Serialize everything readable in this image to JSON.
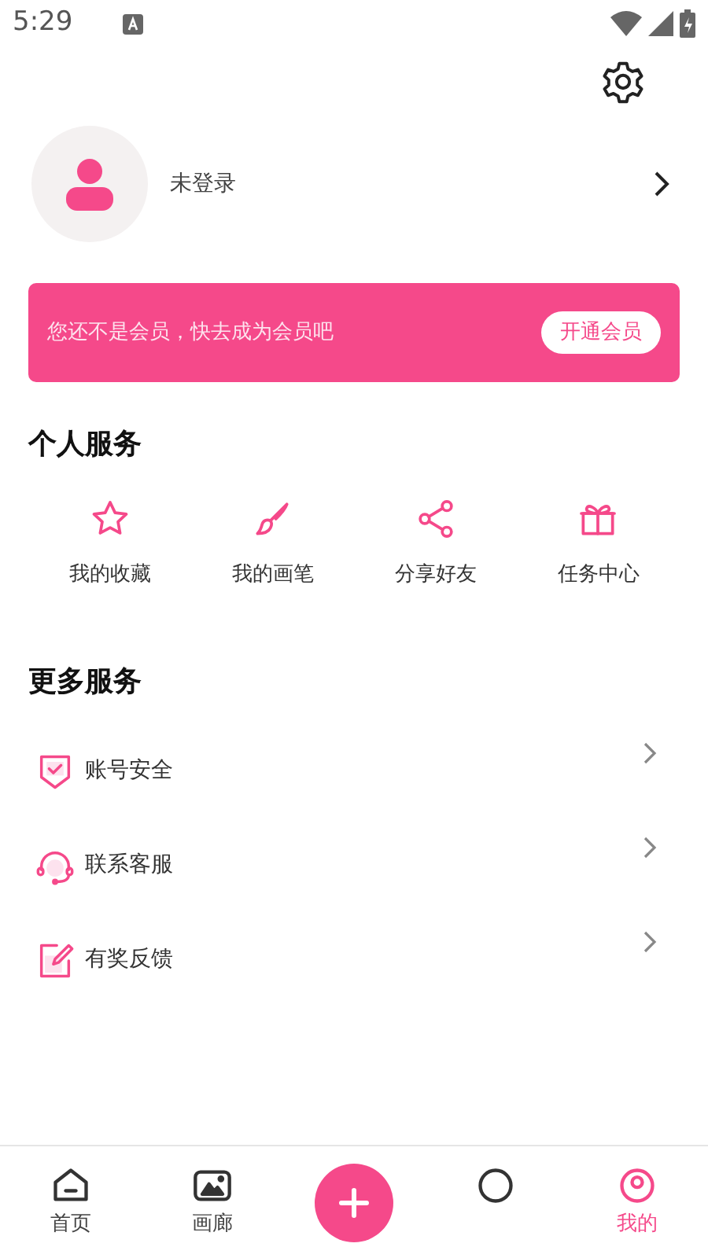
{
  "status_bar": {
    "time": "5:29"
  },
  "profile": {
    "name": "未登录"
  },
  "vip_banner": {
    "text": "您还不是会员，快去成为会员吧",
    "button": "开通会员"
  },
  "personal_services": {
    "title": "个人服务",
    "items": [
      {
        "kind": "star",
        "label": "我的收藏"
      },
      {
        "kind": "brush",
        "label": "我的画笔"
      },
      {
        "kind": "share",
        "label": "分享好友"
      },
      {
        "kind": "gift",
        "label": "任务中心"
      }
    ]
  },
  "more_services": {
    "title": "更多服务",
    "items": [
      {
        "kind": "shield",
        "label": "账号安全"
      },
      {
        "kind": "headset",
        "label": "联系客服"
      },
      {
        "kind": "edit",
        "label": "有奖反馈"
      }
    ]
  },
  "bottom_nav": [
    {
      "kind": "home",
      "label": "首页",
      "selected": false
    },
    {
      "kind": "gallery",
      "label": "画廊",
      "selected": false
    },
    {
      "kind": "add",
      "selected": false
    },
    {
      "kind": "circle",
      "selected": false
    },
    {
      "kind": "user",
      "label": "我的",
      "selected": true
    }
  ]
}
